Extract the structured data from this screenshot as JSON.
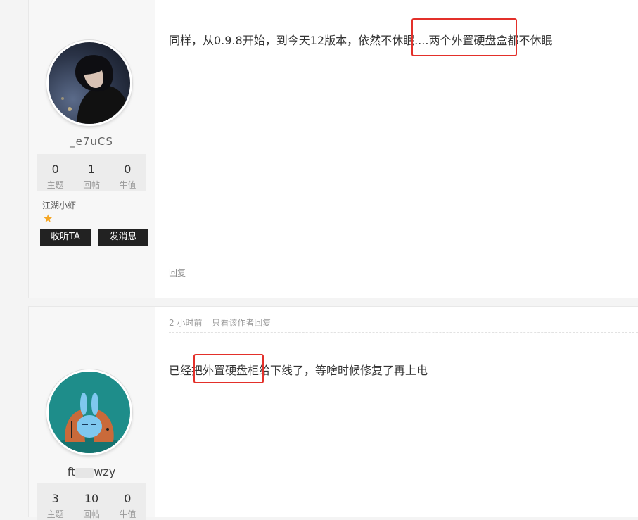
{
  "posts": [
    {
      "user": {
        "name_visible": "_e7uCS"
      },
      "stats": [
        {
          "value": "0",
          "label": "主题"
        },
        {
          "value": "1",
          "label": "回帖"
        },
        {
          "value": "0",
          "label": "牛值"
        }
      ],
      "level": "江湖小虾",
      "follow_label": "收听TA",
      "message_label": "发消息",
      "text": "同样，从0.9.8开始，到今天12版本，依然不休眠....两个外置硬盘盒都不休眠",
      "reply_label": "回复"
    },
    {
      "user": {
        "name_start": "ft",
        "name_end": "wzy"
      },
      "stats": [
        {
          "value": "3",
          "label": "主题"
        },
        {
          "value": "10",
          "label": "回帖"
        },
        {
          "value": "0",
          "label": "牛值"
        }
      ],
      "time": "2 小时前",
      "only_author": "只看该作者回复",
      "text": "已经把外置硬盘柜给下线了，等啥时候修复了再上电"
    }
  ],
  "colors": {
    "highlight": "#e3302a",
    "star": "#f5a623"
  }
}
